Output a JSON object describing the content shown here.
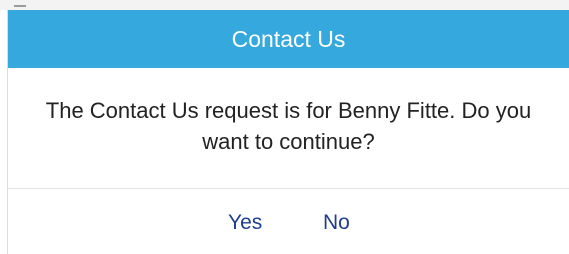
{
  "dialog": {
    "title": "Contact Us",
    "message_line_1": "The Contact Us request is for Benny Fitte. Do you",
    "message_line_2": "want to continue?",
    "buttons": {
      "yes": "Yes",
      "no": "No"
    }
  },
  "colors": {
    "header_bg": "#35a9de",
    "header_text": "#ffffff",
    "button_text": "#1f3f8c",
    "message_text": "#222222"
  }
}
